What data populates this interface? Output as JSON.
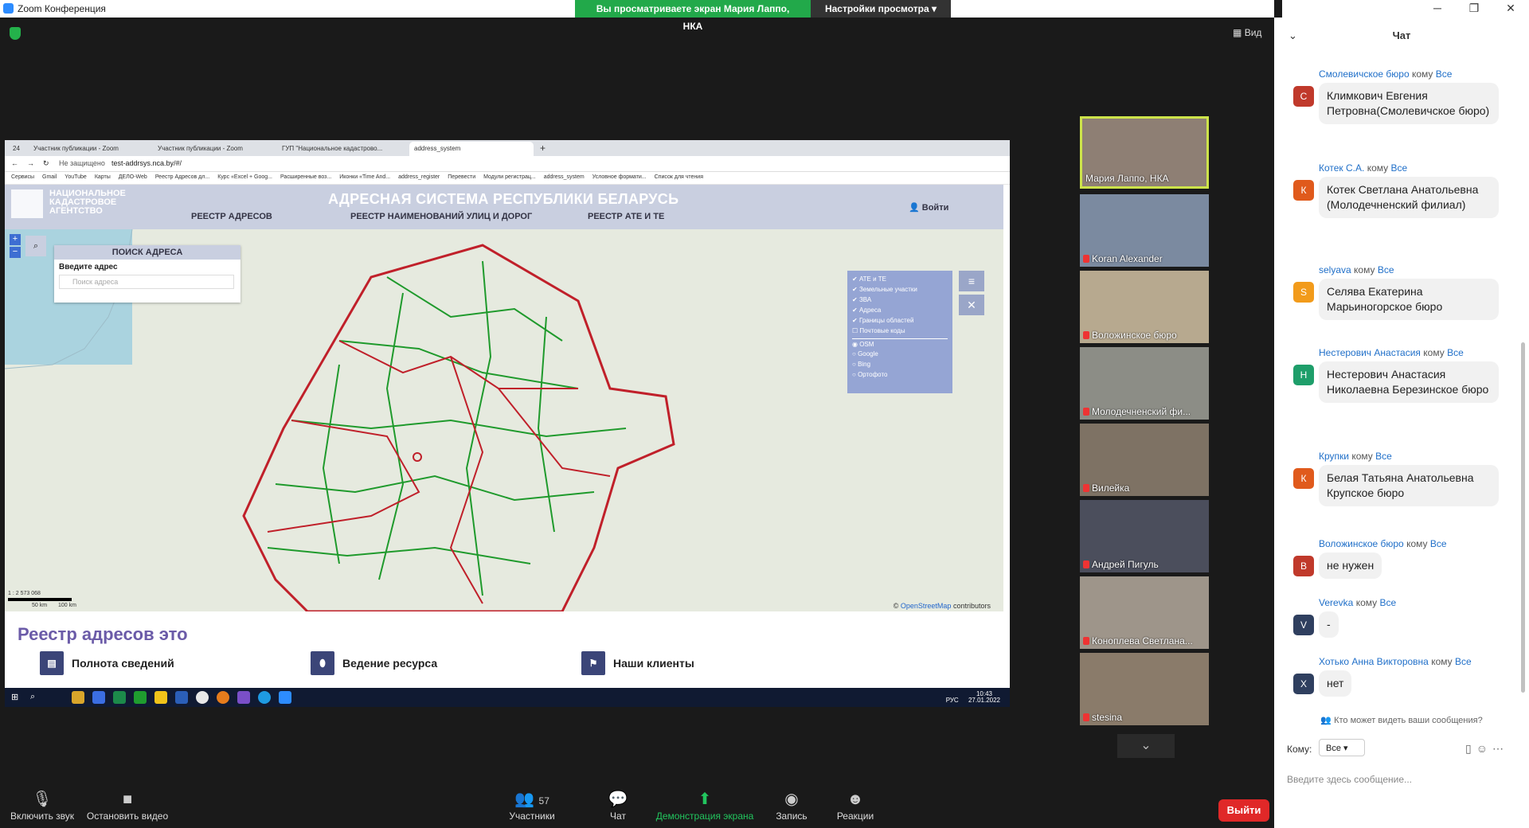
{
  "app": {
    "title": "Zoom Конференция",
    "sharing_text": "Вы просматриваете экран Мария Лаппо, НКА",
    "view_options": "Настройки просмотра",
    "view_button": "Вид"
  },
  "browser": {
    "tabs": [
      {
        "label": "24"
      },
      {
        "label": "Участник публикации - Zoom"
      },
      {
        "label": "Участник публикации - Zoom"
      },
      {
        "label": "ГУП \"Национальное кадастрово..."
      },
      {
        "label": "address_system"
      }
    ],
    "not_secure": "Не защищено",
    "url": "test-addrsys.nca.by/#/",
    "bookmarks": [
      "Сервисы",
      "Gmail",
      "YouTube",
      "Карты",
      "ДЕЛО-Web",
      "Реестр Адресов дл...",
      "Курс «Excel + Goog...",
      "Расширенные воз...",
      "Иконки «Time And...",
      "address_register",
      "Перевести",
      "Модули регистрац...",
      "address_system",
      "Условное формати...",
      "Список для чтения"
    ]
  },
  "site": {
    "logo_text": "НАЦИОНАЛЬНОЕ КАДАСТРОВОЕ АГЕНТСТВО",
    "title": "АДРЕСНАЯ СИСТЕМА РЕСПУБЛИКИ БЕЛАРУСЬ",
    "nav": [
      "РЕЕСТР АДРЕСОВ",
      "РЕЕСТР НАИМЕНОВАНИЙ УЛИЦ И ДОРОГ",
      "РЕЕСТР АТЕ И ТЕ"
    ],
    "login": "Войти",
    "search": {
      "header": "ПОИСК АДРЕСА",
      "label": "Введите адрес",
      "placeholder": "Поиск адреса"
    },
    "layers": [
      "АТЕ и ТЕ",
      "Земельные участки",
      "ЗВА",
      "Адреса",
      "Границы областей",
      "Почтовые коды"
    ],
    "basemaps": [
      "OSM",
      "Google",
      "Bing",
      "Ортофото"
    ],
    "osm_credit_prefix": "©",
    "osm_credit_link": "OpenStreetMap",
    "osm_credit_suffix": "contributors",
    "scale": "1 : 2 573 068",
    "scale_marks": [
      "50 km",
      "100 km"
    ],
    "section_title": "Реестр адресов это",
    "features": [
      "Полнота сведений",
      "Ведение ресурса",
      "Наши клиенты"
    ]
  },
  "taskbar": {
    "lang": "РУС",
    "time": "10:43",
    "date": "27.01.2022"
  },
  "participants": [
    {
      "name": "Мария Лаппо, НКА",
      "muted": false
    },
    {
      "name": "Koran Alexander",
      "muted": true
    },
    {
      "name": "Воложинское бюро",
      "muted": true
    },
    {
      "name": "Молодечненский фи...",
      "muted": true
    },
    {
      "name": "Вилейка",
      "muted": true
    },
    {
      "name": "Андрей Пигуль",
      "muted": true
    },
    {
      "name": "Коноплева Светлана...",
      "muted": true
    },
    {
      "name": "stesina",
      "muted": true
    }
  ],
  "chat": {
    "title": "Чат",
    "to_word": "кому",
    "messages": [
      {
        "from": "Смолевичское бюро",
        "to": "Все",
        "initial": "С",
        "color": "#c0392b",
        "text": "Климкович Евгения Петровна(Смолевичское бюро)"
      },
      {
        "from": "Котек С.А.",
        "to": "Все",
        "initial": "К",
        "color": "#e05a1c",
        "text": "Котек Светлана Анатольевна (Молодечненский филиал)"
      },
      {
        "from": "selyava",
        "to": "Все",
        "initial": "S",
        "color": "#f29b1b",
        "text": "Селява Екатерина Марьиногорское бюро"
      },
      {
        "from": "Нестерович Анастасия",
        "to": "Все",
        "initial": "Н",
        "color": "#1e9e6a",
        "text": "Нестерович Анастасия Николаевна Березинское бюро"
      },
      {
        "from": "Крупки",
        "to": "Все",
        "initial": "К",
        "color": "#e05a1c",
        "text": "Белая Татьяна Анатольевна Крупское бюро"
      },
      {
        "from": "Воложинское бюро",
        "to": "Все",
        "initial": "В",
        "color": "#c0392b",
        "text": "не нужен"
      },
      {
        "from": "Verevka",
        "to": "Все",
        "initial": "V",
        "color": "#2f3f5f",
        "text": "-"
      },
      {
        "from": "Хотько Анна Викторовна",
        "to": "Все",
        "initial": "Х",
        "color": "#2f3f5f",
        "text": "нет"
      }
    ],
    "who_sees": "Кто может видеть ваши сообщения?",
    "to_label": "Кому:",
    "to_value": "Все",
    "input_placeholder": "Введите здесь сообщение..."
  },
  "toolbar": {
    "mute": "Включить звук",
    "video": "Остановить видео",
    "participants": "Участники",
    "participants_count": "57",
    "chat": "Чат",
    "share": "Демонстрация экрана",
    "record": "Запись",
    "reactions": "Реакции",
    "exit": "Выйти"
  },
  "colors": {
    "share_green": "#22a94a",
    "exit_red": "#e02828",
    "active_speaker": "#cde34a",
    "region_border": "#c0202a",
    "district_border": "#1f9a2c"
  }
}
